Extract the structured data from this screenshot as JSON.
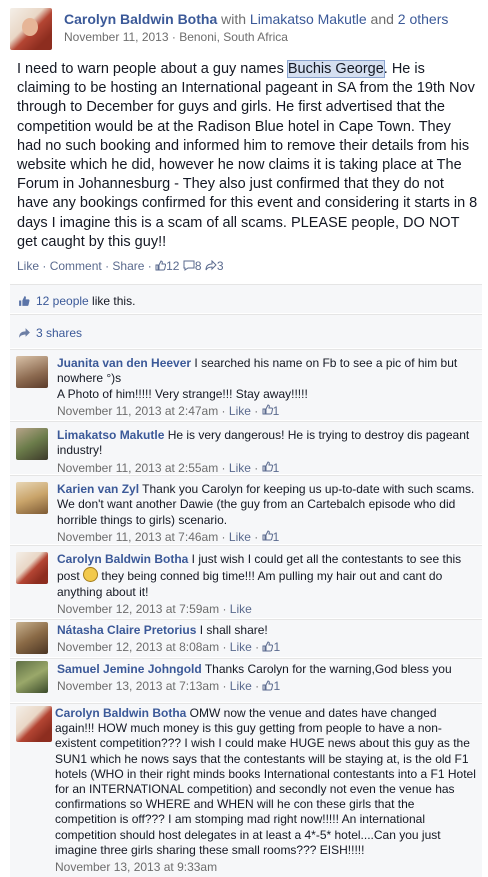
{
  "post": {
    "author": "Carolyn Baldwin Botha",
    "with_text": "with",
    "tagged": "Limakatso Makutle",
    "and_text": "and",
    "others": "2 others",
    "date": "November 11, 2013",
    "separator": "·",
    "location": "Benoni, South Africa",
    "body_before": "I need to warn people about a guy names ",
    "body_highlight": "Buchis George",
    "body_after": ". He is claiming to be hosting an International pageant in SA from the 19th Nov through to December for guys and girls. He first advertised that the competition would be at the Radison Blue hotel in Cape Town. They had no such booking and informed him to remove their details from his website which he did, however he now claims it is taking place at The Forum in Johannesburg - They also just confirmed that they do not have any bookings confirmed for this event and considering it starts in 8 days I imagine this is a scam of all scams. PLEASE people, DO NOT get caught by this guy!!",
    "like_label": "Like",
    "comment_label": "Comment",
    "share_label": "Share",
    "dot": "·",
    "like_count": "12",
    "comment_count": "8",
    "share_count": "3"
  },
  "likes_summary": {
    "count_link": "12 people",
    "suffix": " like this."
  },
  "shares_summary": {
    "label": "3 shares"
  },
  "comments": [
    {
      "name": "Juanita van den Heever",
      "text": " I searched his name on Fb to see a pic of him but nowhere °)s",
      "text2": "A Photo of him!!!!! Very strange!!! Stay away!!!!!",
      "time": "November 11, 2013 at 2:47am",
      "like": "Like",
      "likes": "1"
    },
    {
      "name": "Limakatso Makutle",
      "text": " He is very dangerous! He is trying to destroy dis pageant industry!",
      "time": "November 11, 2013 at 2:55am",
      "like": "Like",
      "likes": "1"
    },
    {
      "name": "Karien van Zyl",
      "text": " Thank you Carolyn for keeping us up-to-date with such scams. We don't want another Dawie (the guy from an Cartebalch episode who did horrible things to girls) scenario.",
      "time": "November 11, 2013 at 7:46am",
      "like": "Like",
      "likes": "1"
    },
    {
      "name": "Carolyn Baldwin Botha",
      "text": " I just wish I could get all the contestants to see this post",
      "text_after": " they being conned big time!!! Am pulling my hair out and cant do anything about it!",
      "time": "November 12, 2013 at 7:59am",
      "like": "Like"
    },
    {
      "name": "Nátasha Claire Pretorius",
      "text": " I shall share!",
      "time": "November 12, 2013 at 8:08am",
      "like": "Like",
      "likes": "1"
    },
    {
      "name": "Samuel Jemine Johngold",
      "text": " Thanks Carolyn for the warning,God bless you",
      "time": "November 13, 2013 at 7:13am",
      "like": "Like",
      "likes": "1"
    },
    {
      "name": "Carolyn Baldwin Botha",
      "text": " OMW now the venue and dates have changed again!!! HOW much money is this guy getting from people to have a non-existent competition??? I wish I could make HUGE news about this guy as the SUN1 which he nows says that the contestants will be staying at, is the old F1 hotels (WHO in their right minds books International contestants into a F1 Hotel for an INTERNATIONAL competition) and secondly not even the venue has confirmations so WHERE and WHEN will he con these girls that the competition is off??? I am stomping mad right now!!!!! An international competition should host delegates in at least a 4*-5* hotel....Can you just imagine three girls sharing these small rooms??? EISH!!!!!",
      "time": "November 13, 2013 at 9:33am"
    }
  ],
  "colors": {
    "link": "#3b5998",
    "meta": "#6d6d6d",
    "panel": "#f6f7f9"
  }
}
